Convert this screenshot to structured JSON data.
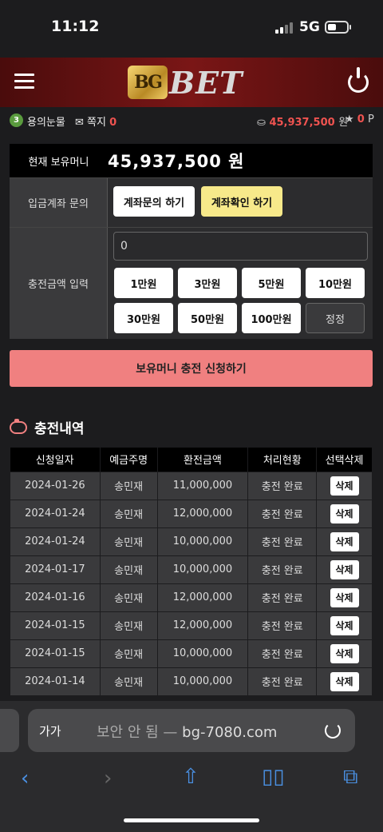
{
  "status_bar": {
    "time": "11:12",
    "network": "5G"
  },
  "header": {
    "logo_badge": "BG",
    "logo_text": "BET"
  },
  "user": {
    "level": "3",
    "name": "용의눈물",
    "memo_label": "쪽지",
    "memo_count": "0",
    "money": "45,937,500",
    "money_unit": "원",
    "points": "0",
    "points_unit": "P"
  },
  "balance": {
    "label": "현재 보유머니",
    "value": "45,937,500 원"
  },
  "account_inquiry": {
    "label": "입금계좌 문의",
    "btn_inquiry": "계좌문의 하기",
    "btn_confirm": "계좌확인 하기"
  },
  "charge": {
    "label": "충전금액 입력",
    "input_value": "0",
    "amounts": [
      "1만원",
      "3만원",
      "5만원",
      "10만원",
      "30만원",
      "50만원",
      "100만원"
    ],
    "reset_label": "정정"
  },
  "submit_label": "보유머니 충전 신청하기",
  "history": {
    "title": "충전내역",
    "columns": [
      "신청일자",
      "예금주명",
      "환전금액",
      "처리현황",
      "선택삭제"
    ],
    "rows": [
      {
        "date": "2024-01-26",
        "name": "송민재",
        "amount": "11,000,000",
        "status": "충전 완료",
        "action": "삭제"
      },
      {
        "date": "2024-01-24",
        "name": "송민재",
        "amount": "12,000,000",
        "status": "충전 완료",
        "action": "삭제"
      },
      {
        "date": "2024-01-24",
        "name": "송민재",
        "amount": "10,000,000",
        "status": "충전 완료",
        "action": "삭제"
      },
      {
        "date": "2024-01-17",
        "name": "송민재",
        "amount": "10,000,000",
        "status": "충전 완료",
        "action": "삭제"
      },
      {
        "date": "2024-01-16",
        "name": "송민재",
        "amount": "12,000,000",
        "status": "충전 완료",
        "action": "삭제"
      },
      {
        "date": "2024-01-15",
        "name": "송민재",
        "amount": "12,000,000",
        "status": "충전 완료",
        "action": "삭제"
      },
      {
        "date": "2024-01-15",
        "name": "송민재",
        "amount": "10,000,000",
        "status": "충전 완료",
        "action": "삭제"
      },
      {
        "date": "2024-01-14",
        "name": "송민재",
        "amount": "10,000,000",
        "status": "충전 완료",
        "action": "삭제"
      }
    ]
  },
  "browser": {
    "aa": "가가",
    "url_prefix": "보안 안 됨 —",
    "url": "bg-7080.com"
  }
}
